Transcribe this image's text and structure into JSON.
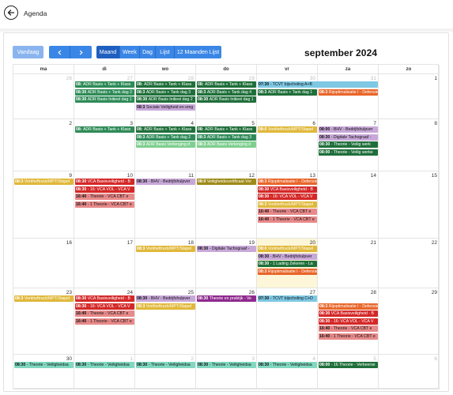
{
  "app": {
    "title": "Agenda"
  },
  "toolbar": {
    "today_label": "Vandaag",
    "views": [
      "Maand",
      "Week",
      "Dag",
      "Lijst",
      "12 Maanden Lijst"
    ],
    "active_view": "Maand",
    "title": "september 2024"
  },
  "weekdays": [
    "ma",
    "di",
    "wo",
    "do",
    "vr",
    "za",
    "zo"
  ],
  "weeks": [
    [
      {
        "d": "26",
        "o": true
      },
      {
        "d": "27",
        "o": true
      },
      {
        "d": "28",
        "o": true
      },
      {
        "d": "29",
        "o": true
      },
      {
        "d": "30",
        "o": true
      },
      {
        "d": "31",
        "o": true
      },
      {
        "d": "1"
      }
    ],
    [
      {
        "d": "2"
      },
      {
        "d": "3"
      },
      {
        "d": "4"
      },
      {
        "d": "5"
      },
      {
        "d": "6"
      },
      {
        "d": "7"
      },
      {
        "d": "8"
      }
    ],
    [
      {
        "d": "9"
      },
      {
        "d": "10"
      },
      {
        "d": "11"
      },
      {
        "d": "12"
      },
      {
        "d": "13"
      },
      {
        "d": "14"
      },
      {
        "d": "15"
      }
    ],
    [
      {
        "d": "16"
      },
      {
        "d": "17"
      },
      {
        "d": "18"
      },
      {
        "d": "19"
      },
      {
        "d": "20",
        "today": true
      },
      {
        "d": "21"
      },
      {
        "d": "22"
      }
    ],
    [
      {
        "d": "23"
      },
      {
        "d": "24"
      },
      {
        "d": "25"
      },
      {
        "d": "26"
      },
      {
        "d": "27"
      },
      {
        "d": "28"
      },
      {
        "d": "29"
      }
    ],
    [
      {
        "d": "30"
      },
      {
        "d": "1",
        "o": true
      },
      {
        "d": "2",
        "o": true
      },
      {
        "d": "3",
        "o": true
      },
      {
        "d": "4",
        "o": true
      },
      {
        "d": "5",
        "o": true
      },
      {
        "d": "6",
        "o": true
      }
    ]
  ],
  "events": [
    {
      "w": 0,
      "c": 1,
      "s": 1,
      "r": 0,
      "t": "08:",
      "x": "ADR Basis + Tank + Klass",
      "bg": "#2e8b57",
      "fg": "#fff"
    },
    {
      "w": 0,
      "c": 2,
      "s": 1,
      "r": 0,
      "t": "08:",
      "x": "ADR Basis + Tank + Klass",
      "bg": "#1f6f3a",
      "fg": "#fff"
    },
    {
      "w": 0,
      "c": 3,
      "s": 1,
      "r": 0,
      "t": "08:",
      "x": "ADR Basis + Tank + Klass",
      "bg": "#1f6f3a",
      "fg": "#fff"
    },
    {
      "w": 0,
      "c": 4,
      "s": 2,
      "r": 0,
      "t": "07:30",
      "x": "- TCVT bijscholing A+B",
      "bg": "#7ec8e3",
      "fg": "#111"
    },
    {
      "w": 0,
      "c": 1,
      "s": 1,
      "r": 1,
      "t": "08:30",
      "x": "ADR Basis + Tank dag 2",
      "bg": "#2e8b57",
      "fg": "#fff"
    },
    {
      "w": 0,
      "c": 2,
      "s": 1,
      "r": 1,
      "t": "08:3",
      "x": "ADR Basis + Tank dag 3",
      "bg": "#1f6f3a",
      "fg": "#fff"
    },
    {
      "w": 0,
      "c": 3,
      "s": 1,
      "r": 1,
      "t": "08:3",
      "x": "ADR Basis + Tank dag 4",
      "bg": "#1f6f3a",
      "fg": "#fff"
    },
    {
      "w": 0,
      "c": 4,
      "s": 1,
      "r": 1,
      "t": "08:3",
      "x": "ADR Basis + Tank dag 1",
      "bg": "#1f6f3a",
      "fg": "#fff"
    },
    {
      "w": 0,
      "c": 5,
      "s": 1,
      "r": 1,
      "t": "08:3",
      "x": "Rijoptimalisatie I - Defensie",
      "bg": "#e8662a",
      "fg": "#fff"
    },
    {
      "w": 0,
      "c": 1,
      "s": 1,
      "r": 2,
      "t": "08:30",
      "x": "ADR Basis Initieel dag 1",
      "bg": "#2e8b57",
      "fg": "#fff"
    },
    {
      "w": 0,
      "c": 2,
      "s": 1,
      "r": 2,
      "t": "08:30",
      "x": "ADR Basis Initieel dag 2",
      "bg": "#1f6f3a",
      "fg": "#fff"
    },
    {
      "w": 0,
      "c": 3,
      "s": 1,
      "r": 2,
      "t": "08:30",
      "x": "ADR Basis Initieel dag 1",
      "bg": "#1f6f3a",
      "fg": "#fff"
    },
    {
      "w": 0,
      "c": 2,
      "s": 1,
      "r": 3,
      "t": "08:3",
      "x": "Sociale Veiligheid en omg",
      "bg": "#c8a8d8",
      "fg": "#111"
    },
    {
      "w": 1,
      "c": 1,
      "s": 1,
      "r": 0,
      "t": "08:",
      "x": "ADR Basis + Tank + Klass",
      "bg": "#2e8b57",
      "fg": "#fff"
    },
    {
      "w": 1,
      "c": 2,
      "s": 1,
      "r": 0,
      "t": "08:",
      "x": "ADR Basis + Tank + Klass",
      "bg": "#1f6f3a",
      "fg": "#fff"
    },
    {
      "w": 1,
      "c": 3,
      "s": 1,
      "r": 0,
      "t": "08:",
      "x": "ADR Basis + Tank + Klass",
      "bg": "#1f6f3a",
      "fg": "#fff"
    },
    {
      "w": 1,
      "c": 4,
      "s": 1,
      "r": 0,
      "t": "08:0",
      "x": "Vorkheftruck/MPT/Stapel",
      "bg": "#e0b83a",
      "fg": "#fff"
    },
    {
      "w": 1,
      "c": 5,
      "s": 1,
      "r": 0,
      "t": "08:00",
      "x": "- BHV - Bedrijfshulpver",
      "bg": "#c8a8d8",
      "fg": "#111"
    },
    {
      "w": 1,
      "c": 2,
      "s": 1,
      "r": 1,
      "t": "08:3",
      "x": "ADR Basis + Tank dag 2",
      "bg": "#2e8b57",
      "fg": "#fff"
    },
    {
      "w": 1,
      "c": 3,
      "s": 1,
      "r": 1,
      "t": "08:3",
      "x": "ADR Basis + Tank dag 3",
      "bg": "#2e8b57",
      "fg": "#fff"
    },
    {
      "w": 1,
      "c": 5,
      "s": 1,
      "r": 1,
      "t": "08:30",
      "x": "- Digitale Tachograaf -",
      "bg": "#c8a8d8",
      "fg": "#111"
    },
    {
      "w": 1,
      "c": 2,
      "s": 1,
      "r": 2,
      "t": "08:3",
      "x": "ADR Basis Verlenging d",
      "bg": "#7fcf8f",
      "fg": "#fff"
    },
    {
      "w": 1,
      "c": 3,
      "s": 1,
      "r": 2,
      "t": "08:3",
      "x": "ADR Basis Verlenging d",
      "bg": "#7fcf8f",
      "fg": "#fff"
    },
    {
      "w": 1,
      "c": 5,
      "s": 1,
      "r": 2,
      "t": "08:30",
      "x": "- Theorie - Veilig werk",
      "bg": "#1f6f3a",
      "fg": "#fff"
    },
    {
      "w": 1,
      "c": 5,
      "s": 1,
      "r": 3,
      "t": "08:00",
      "x": "- Theorie - Veilig werke",
      "bg": "#1f6f3a",
      "fg": "#fff"
    },
    {
      "w": 2,
      "c": 0,
      "s": 1,
      "r": 0,
      "t": "08:3",
      "x": "Vorkheftruck/MPT/Stapel",
      "bg": "#e0b83a",
      "fg": "#fff"
    },
    {
      "w": 2,
      "c": 1,
      "s": 1,
      "r": 0,
      "t": "08:30",
      "x": "VCA Basisveiligheid - B",
      "bg": "#d42828",
      "fg": "#fff"
    },
    {
      "w": 2,
      "c": 2,
      "s": 1,
      "r": 0,
      "t": "08:30",
      "x": "- BHV - Bedrijfshulpver",
      "bg": "#c8a8d8",
      "fg": "#111"
    },
    {
      "w": 2,
      "c": 3,
      "s": 1,
      "r": 0,
      "t": "08:0",
      "x": "Veiligheidscertificaat Vor",
      "bg": "#9e8a18",
      "fg": "#fff"
    },
    {
      "w": 2,
      "c": 4,
      "s": 1,
      "r": 0,
      "t": "08:3",
      "x": "Rijoptimalisatie I - Defensie",
      "bg": "#e8662a",
      "fg": "#fff"
    },
    {
      "w": 2,
      "c": 1,
      "s": 1,
      "r": 1,
      "t": "08:30",
      "x": "- 16:",
      "x2": "VCA VOL - VCA V",
      "bg": "#d42828",
      "fg": "#fff"
    },
    {
      "w": 2,
      "c": 4,
      "s": 1,
      "r": 1,
      "t": "08:30",
      "x": "VCA Basisveiligheid - B",
      "bg": "#d42828",
      "fg": "#fff"
    },
    {
      "w": 2,
      "c": 1,
      "s": 1,
      "r": 2,
      "t": "16:40",
      "x": "- Theorie - VCA CBT e",
      "bg": "#e88a8a",
      "fg": "#111"
    },
    {
      "w": 2,
      "c": 4,
      "s": 1,
      "r": 2,
      "t": "08:30",
      "x": "- 16:",
      "x2": "VCA VOL - VCA V",
      "bg": "#d42828",
      "fg": "#fff"
    },
    {
      "w": 2,
      "c": 1,
      "s": 1,
      "r": 3,
      "t": "16:40",
      "x": "- 1",
      "x2": "Theorie - VCA CBT e",
      "bg": "#e88a8a",
      "fg": "#111"
    },
    {
      "w": 2,
      "c": 4,
      "s": 1,
      "r": 3,
      "t": "08:3",
      "x": "Vorkheftruck/MPT/Stapel",
      "bg": "#e0b83a",
      "fg": "#fff"
    },
    {
      "w": 2,
      "c": 4,
      "s": 1,
      "r": 4,
      "t": "16:40",
      "x": "- Theorie - VCA CBT e",
      "bg": "#e88a8a",
      "fg": "#111"
    },
    {
      "w": 2,
      "c": 4,
      "s": 1,
      "r": 5,
      "t": "16:40",
      "x": "- 1",
      "x2": "Theorie - VCA CBT e",
      "bg": "#e88a8a",
      "fg": "#111"
    },
    {
      "w": 3,
      "c": 2,
      "s": 1,
      "r": 0,
      "t": "08:3",
      "x": "Vorkheftruck/MPT/Stapel",
      "bg": "#e0b83a",
      "fg": "#fff"
    },
    {
      "w": 3,
      "c": 3,
      "s": 1,
      "r": 0,
      "t": "08:30",
      "x": "- Digitale Tachograaf -",
      "bg": "#c8a8d8",
      "fg": "#111"
    },
    {
      "w": 3,
      "c": 4,
      "s": 1,
      "r": 0,
      "t": "08:0",
      "x": "Vorkheftruck/MPT/Stapel",
      "bg": "#e0b83a",
      "fg": "#fff"
    },
    {
      "w": 3,
      "c": 4,
      "s": 1,
      "r": 1,
      "t": "08:30",
      "x": "- BHV - Bedrijfshulpver",
      "bg": "#c8a8d8",
      "fg": "#111"
    },
    {
      "w": 3,
      "c": 4,
      "s": 1,
      "r": 2,
      "t": "08:30",
      "x": "- 1",
      "x2": "Lading Zekeren - La",
      "bg": "#1f6f3a",
      "fg": "#fff"
    },
    {
      "w": 3,
      "c": 4,
      "s": 1,
      "r": 3,
      "t": "08:3",
      "x": "Rijoptimalisatie I - Defensie",
      "bg": "#e8662a",
      "fg": "#fff"
    },
    {
      "w": 4,
      "c": 0,
      "s": 1,
      "r": 0,
      "t": "08:3",
      "x": "Vorkheftruck/MPT/Stapel",
      "bg": "#e0b83a",
      "fg": "#fff"
    },
    {
      "w": 4,
      "c": 1,
      "s": 1,
      "r": 0,
      "t": "08:30",
      "x": "VCA Basisveiligheid - B",
      "bg": "#d42828",
      "fg": "#fff"
    },
    {
      "w": 4,
      "c": 2,
      "s": 1,
      "r": 0,
      "t": "08:30",
      "x": "- BHV - Bedrijfshulpver",
      "bg": "#c8a8d8",
      "fg": "#111"
    },
    {
      "w": 4,
      "c": 3,
      "s": 1,
      "r": 0,
      "t": "08:30",
      "x": "Theorie en praktijk - Ve",
      "bg": "#8e2a8e",
      "fg": "#fff"
    },
    {
      "w": 4,
      "c": 4,
      "s": 1,
      "r": 0,
      "t": "07:30",
      "x": "- TCVT bijscholing C+D",
      "bg": "#7ec8e3",
      "fg": "#111"
    },
    {
      "w": 4,
      "c": 1,
      "s": 1,
      "r": 1,
      "t": "08:30",
      "x": "- 16:",
      "x2": "VCA VOL - VCA V",
      "bg": "#d42828",
      "fg": "#fff"
    },
    {
      "w": 4,
      "c": 2,
      "s": 1,
      "r": 1,
      "t": "08:3",
      "x": "Vorkheftruck/MPT/Stapel",
      "bg": "#e0b83a",
      "fg": "#fff"
    },
    {
      "w": 4,
      "c": 5,
      "s": 1,
      "r": 1,
      "t": "08:3",
      "x": "Rijoptimalisatie I - Defensie",
      "bg": "#e8662a",
      "fg": "#fff"
    },
    {
      "w": 4,
      "c": 1,
      "s": 1,
      "r": 2,
      "t": "16:40",
      "x": "- Theorie - VCA CBT e",
      "bg": "#e88a8a",
      "fg": "#111"
    },
    {
      "w": 4,
      "c": 5,
      "s": 1,
      "r": 2,
      "t": "08:30",
      "x": "VCA Basisveiligheid - B",
      "bg": "#d42828",
      "fg": "#fff"
    },
    {
      "w": 4,
      "c": 1,
      "s": 1,
      "r": 3,
      "t": "16:40",
      "x": "- 1",
      "x2": "Theorie - VCA CBT e",
      "bg": "#e88a8a",
      "fg": "#111"
    },
    {
      "w": 4,
      "c": 5,
      "s": 1,
      "r": 3,
      "t": "08:30",
      "x": "- 16:",
      "x2": "VCA VOL - VCA V",
      "bg": "#d42828",
      "fg": "#fff"
    },
    {
      "w": 4,
      "c": 5,
      "s": 1,
      "r": 4,
      "t": "16:40",
      "x": "- Theorie - VCA CBT e",
      "bg": "#e88a8a",
      "fg": "#111"
    },
    {
      "w": 4,
      "c": 5,
      "s": 1,
      "r": 5,
      "t": "16:40",
      "x": "- 1",
      "x2": "Theorie - VCA CBT e",
      "bg": "#e88a8a",
      "fg": "#111"
    },
    {
      "w": 5,
      "c": 0,
      "s": 1,
      "r": 0,
      "t": "08:30",
      "x": "- Theorie - Veiligheidsa",
      "bg": "#7fd8bf",
      "fg": "#111"
    },
    {
      "w": 5,
      "c": 1,
      "s": 1,
      "r": 0,
      "t": "08:30",
      "x": "- Theorie - Veiligheidsa",
      "bg": "#7fd8bf",
      "fg": "#111"
    },
    {
      "w": 5,
      "c": 2,
      "s": 1,
      "r": 0,
      "t": "08:30",
      "x": "- Theorie - Veiligheidsa",
      "bg": "#7fd8bf",
      "fg": "#111"
    },
    {
      "w": 5,
      "c": 3,
      "s": 1,
      "r": 0,
      "t": "08:30",
      "x": "- Theorie - Veiligheidsa",
      "bg": "#7fd8bf",
      "fg": "#111"
    },
    {
      "w": 5,
      "c": 4,
      "s": 1,
      "r": 0,
      "t": "08:30",
      "x": "- Theorie - Veiligheidsa",
      "bg": "#7fd8bf",
      "fg": "#111"
    },
    {
      "w": 5,
      "c": 5,
      "s": 1,
      "r": 0,
      "t": "08:00",
      "x": "- 16",
      "x2": "Theorie - Verkeerse",
      "bg": "#1f6f3a",
      "fg": "#fff"
    }
  ]
}
